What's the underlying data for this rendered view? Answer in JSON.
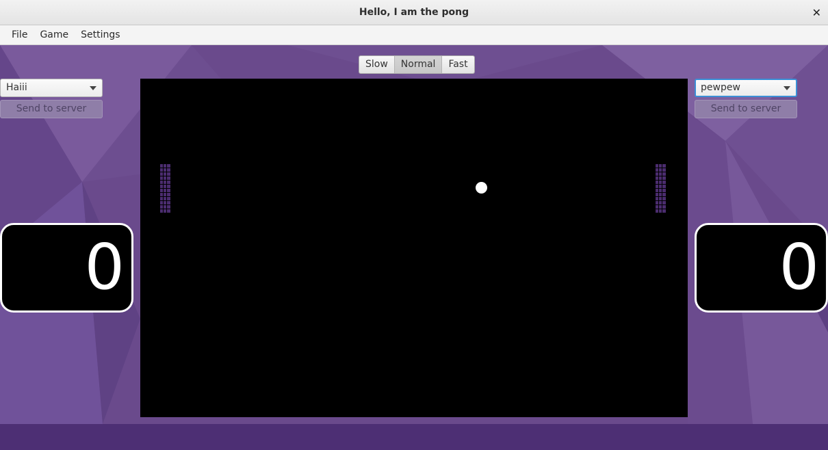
{
  "window": {
    "title": "Hello, I am the pong",
    "close_glyph": "✕"
  },
  "menu": {
    "items": [
      "File",
      "Game",
      "Settings"
    ]
  },
  "speed": {
    "options": [
      "Slow",
      "Normal",
      "Fast"
    ],
    "selected": "Normal"
  },
  "left_player": {
    "name_select_value": "Haiii",
    "send_label": "Send to server",
    "score": "0",
    "paddle_color": "#4a2c6e"
  },
  "right_player": {
    "name_select_value": "pewpew",
    "send_label": "Send to server",
    "score": "0",
    "paddle_color": "#4a2c6e"
  },
  "colors": {
    "background_purple": "#6a4a8c",
    "status_bar": "#4d2f74",
    "court": "#000000",
    "ball": "#ffffff",
    "focus_ring": "#3b8fd6"
  }
}
